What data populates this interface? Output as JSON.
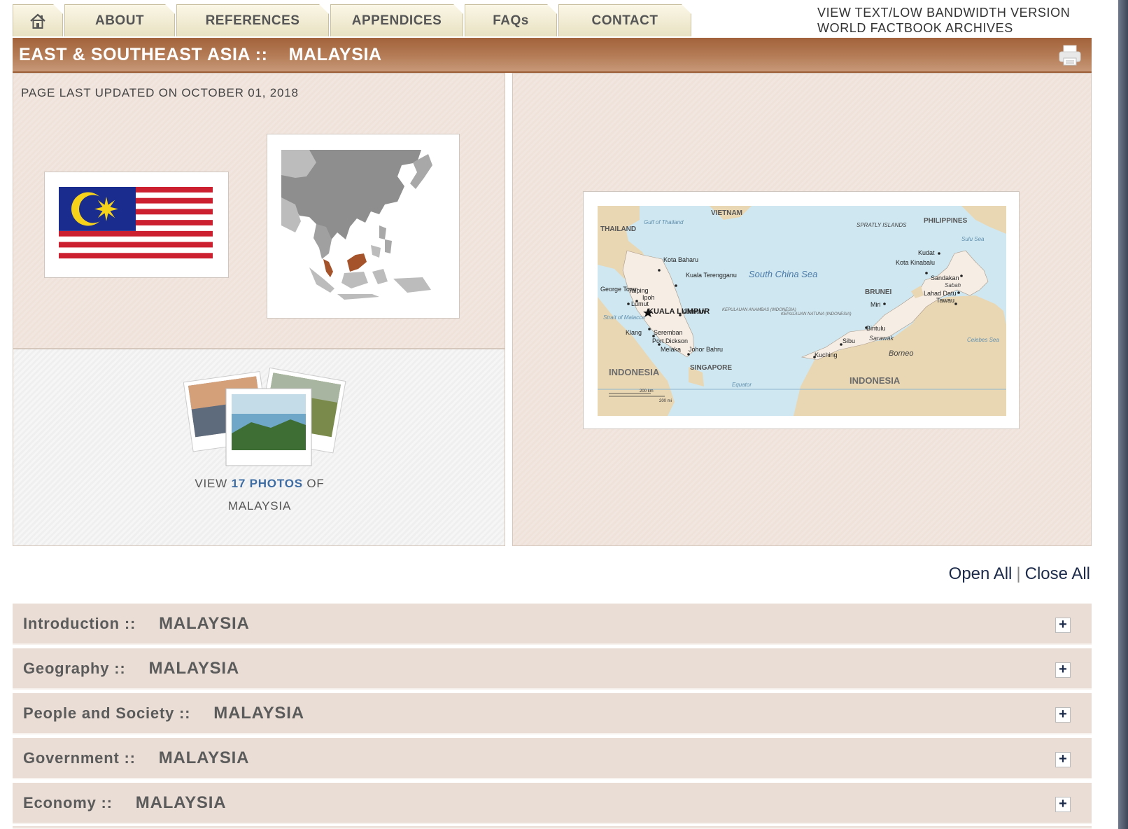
{
  "nav": {
    "home_icon": "house-icon",
    "tabs": [
      "ABOUT",
      "REFERENCES",
      "APPENDICES",
      "FAQs",
      "CONTACT"
    ]
  },
  "toplinks": [
    "VIEW TEXT/LOW BANDWIDTH VERSION",
    "WORLD FACTBOOK ARCHIVES"
  ],
  "header": {
    "region": "EAST & SOUTHEAST ASIA ::",
    "country": "MALAYSIA",
    "print_icon": "printer-icon",
    "bar_color": "#a9673f"
  },
  "updated": "PAGE LAST UPDATED ON OCTOBER 01, 2018",
  "photos": {
    "prefix": "VIEW",
    "count_link": "17 PHOTOS",
    "suffix": "OF",
    "country": "MALAYSIA",
    "link_color": "#3e6da4"
  },
  "map_labels": {
    "vietnam": "VIETNAM",
    "thailand": "THAILAND",
    "philippines": "PHILIPPINES",
    "spratly": "SPRATLY ISLANDS",
    "gulf": "Gulf of Thailand",
    "scs": "South China Sea",
    "sulu": "Sulu Sea",
    "celebes": "Celebes Sea",
    "kl": "KUALA LUMPUR",
    "brunei": "BRUNEI",
    "singapore": "SINGAPORE",
    "indonesia_w": "INDONESIA",
    "indonesia_e": "INDONESIA",
    "borneo": "Borneo",
    "sarawak": "Sarawak",
    "sabah": "Sabah",
    "kota_bharu": "Kota Baharu",
    "kt": "Kuala Terengganu",
    "kuantan": "Kuantan",
    "ipoh": "Ipoh",
    "taiping": "Taiping",
    "georgetown": "George Town",
    "lumut": "Lumut",
    "klang": "Klang",
    "seremban": "Seremban",
    "pd": "Port Dickson",
    "melaka": "Melaka",
    "johor": "Johor Bahru",
    "kuching": "Kuching",
    "sibu": "Sibu",
    "bintulu": "Bintulu",
    "miri": "Miri",
    "kk": "Kota Kinabalu",
    "kudat": "Kudat",
    "sandakan": "Sandakan",
    "lahad": "Lahad Datu",
    "tawau": "Tawau",
    "equator": "Equator",
    "strait": "Strait of Malacca",
    "anambas": "KEPULAUAN ANAMBAS (INDONESIA)",
    "natuna": "KEPULAUAN NATUNA (INDONESIA)",
    "scale_km": "200 km",
    "scale_mi": "200 mi"
  },
  "controls": {
    "open_all": "Open All",
    "separator": "|",
    "close_all": "Close All"
  },
  "sections": [
    {
      "name": "Introduction ::",
      "country": "MALAYSIA"
    },
    {
      "name": "Geography ::",
      "country": "MALAYSIA"
    },
    {
      "name": "People and Society ::",
      "country": "MALAYSIA"
    },
    {
      "name": "Government ::",
      "country": "MALAYSIA"
    },
    {
      "name": "Economy ::",
      "country": "MALAYSIA"
    }
  ],
  "expand_icon": "plus-icon",
  "expand_symbol": "+"
}
